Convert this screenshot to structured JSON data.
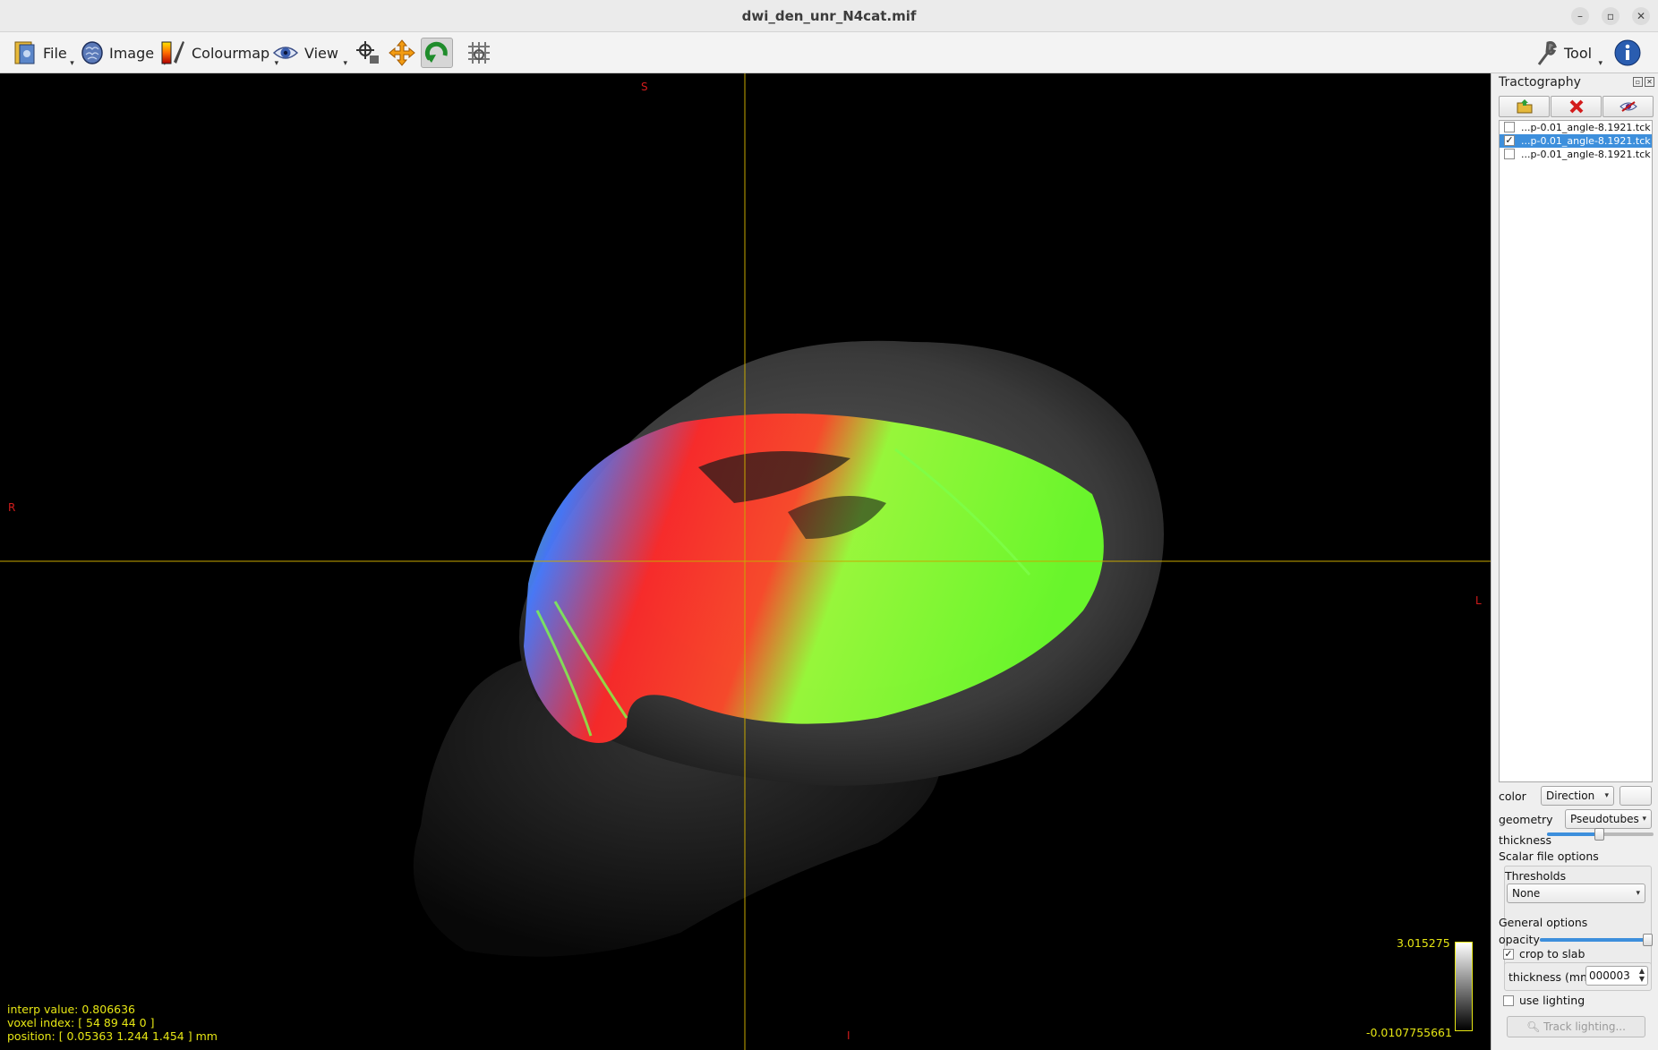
{
  "window": {
    "title": "dwi_den_unr_N4cat.mif"
  },
  "toolbar": {
    "file_label": "File",
    "image_label": "Image",
    "colourmap_label": "Colourmap",
    "view_label": "View",
    "tool_label": "Tool"
  },
  "viewport": {
    "orientation": {
      "top": "S",
      "bottom": "I",
      "left": "R",
      "right": "L"
    },
    "interp_value": "interp value: 0.806636",
    "voxel_index": "voxel index: [ 54 89 44 0 ]",
    "position": "position: [ 0.05363 1.244 1.454 ] mm",
    "colorbar_max": "3.015275",
    "colorbar_min": "-0.0107755661",
    "colors": {
      "crosshair": "#c8a800",
      "hud_text": "#e6e614",
      "orientation": "#d41c1c"
    }
  },
  "panel": {
    "title": "Tractography",
    "tracks": [
      {
        "name": "...p-0.01_angle-8.1921.tck",
        "checked": false,
        "selected": false
      },
      {
        "name": "...p-0.01_angle-8.1921.tck",
        "checked": true,
        "selected": true
      },
      {
        "name": "...p-0.01_angle-8.1921.tck",
        "checked": false,
        "selected": false
      }
    ],
    "color_label": "color",
    "color_value": "Direction",
    "geometry_label": "geometry",
    "geometry_value": "Pseudotubes",
    "thickness_label": "thickness",
    "thickness_level": 0.5,
    "scalar_options_label": "Scalar file options",
    "thresholds_label": "Thresholds",
    "thresholds_value": "None",
    "general_options_label": "General options",
    "opacity_label": "opacity",
    "opacity_level": 1.0,
    "crop_to_slab_label": "crop to slab",
    "crop_to_slab_checked": true,
    "slab_thickness_label": "thickness (mm)",
    "slab_thickness_value": "000003",
    "use_lighting_label": "use lighting",
    "use_lighting_checked": false,
    "track_lighting_label": "Track lighting..."
  }
}
